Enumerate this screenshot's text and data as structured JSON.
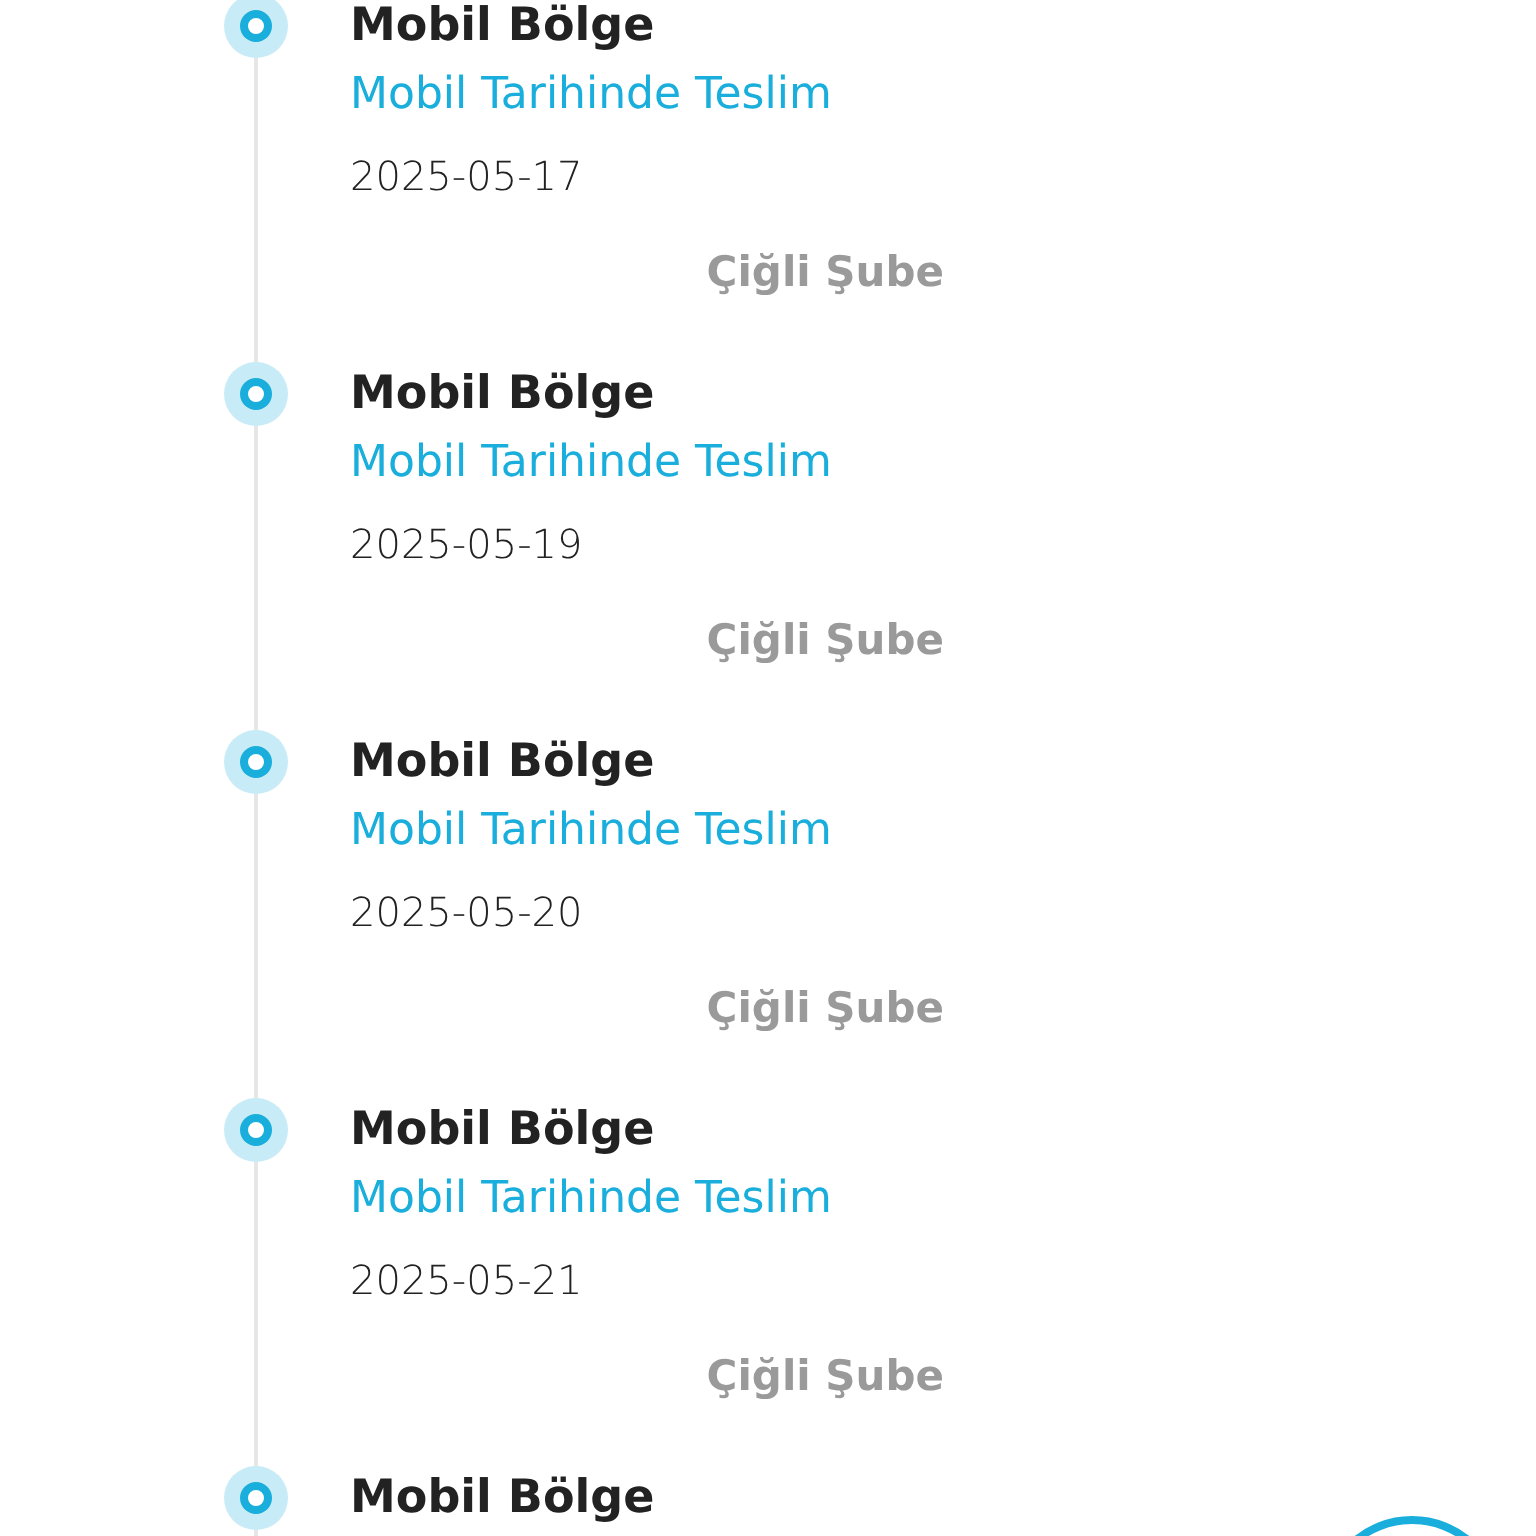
{
  "timeline": [
    {
      "title": "Mobil Bölge",
      "status": "Mobil Tarihinde Teslim",
      "date": "2025-05-17",
      "branch": "Çiğli Şube"
    },
    {
      "title": "Mobil Bölge",
      "status": "Mobil Tarihinde Teslim",
      "date": "2025-05-19",
      "branch": "Çiğli Şube"
    },
    {
      "title": "Mobil Bölge",
      "status": "Mobil Tarihinde Teslim",
      "date": "2025-05-20",
      "branch": "Çiğli Şube"
    },
    {
      "title": "Mobil Bölge",
      "status": "Mobil Tarihinde Teslim",
      "date": "2025-05-21",
      "branch": "Çiğli Şube"
    },
    {
      "title": "Mobil Bölge"
    }
  ]
}
